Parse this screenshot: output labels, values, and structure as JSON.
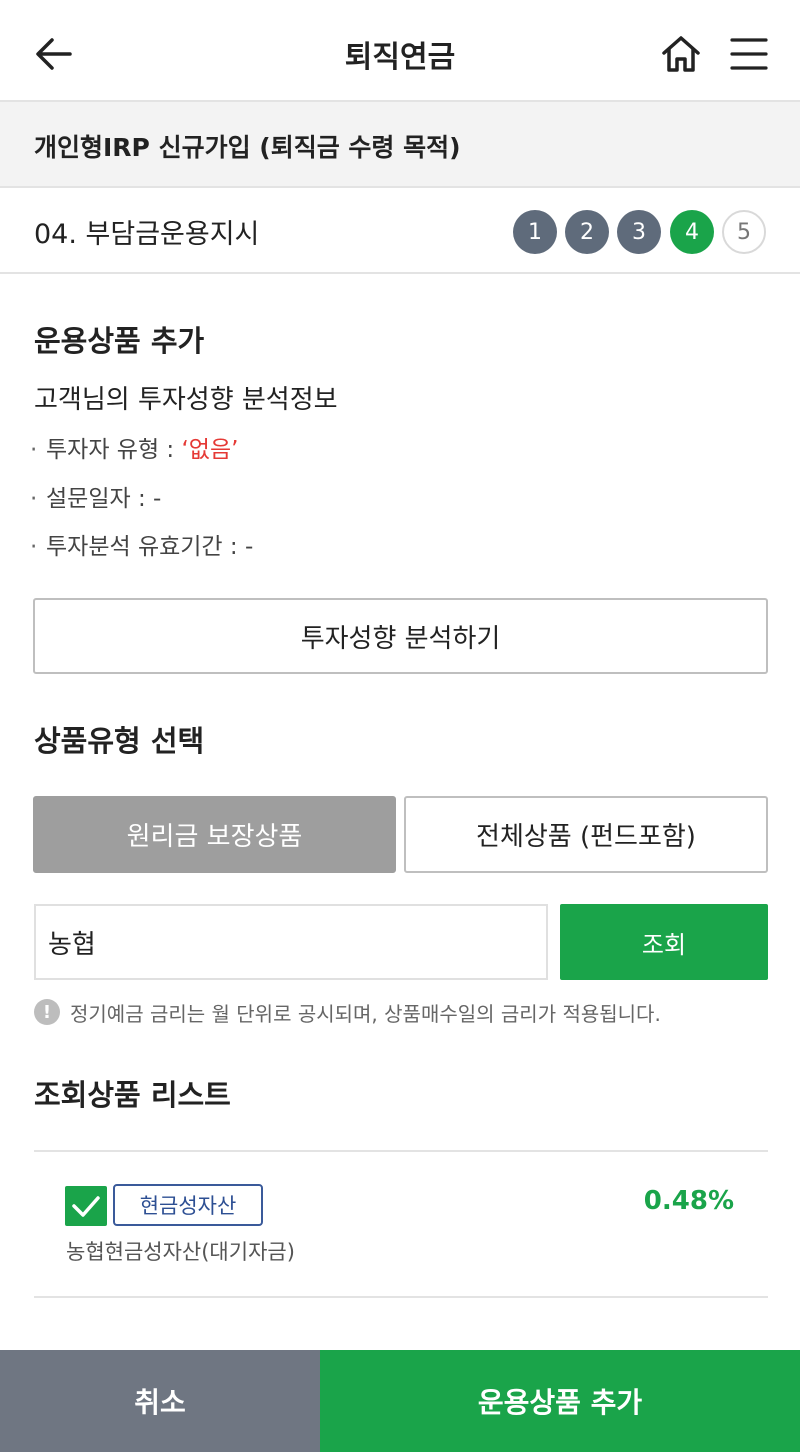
{
  "header": {
    "title": "퇴직연금",
    "back_icon": "arrow-left-icon",
    "home_icon": "home-icon",
    "menu_icon": "hamburger-menu-icon"
  },
  "subtitle": "개인형IRP 신규가입 (퇴직금 수령 목적)",
  "step": {
    "title": "04. 부담금운용지시",
    "steps": [
      "1",
      "2",
      "3",
      "4",
      "5"
    ],
    "current": 4
  },
  "product_add": {
    "title": "운용상품 추가",
    "analysis_heading": "고객님의 투자성향 분석정보",
    "investor_type_label": "투자자 유형 : ",
    "investor_type_value": "‘없음’",
    "survey_date_label": "설문일자 : -",
    "validity_label": "투자분석 유효기간 : -",
    "analyze_button": "투자성향 분석하기"
  },
  "product_type": {
    "title": "상품유형 선택",
    "option_guaranteed": "원리금 보장상품",
    "option_all": "전체상품 (펀드포함)"
  },
  "search": {
    "value": "농협",
    "button": "조회",
    "notice": "정기예금 금리는 월 단위로 공시되며, 상품매수일의 금리가 적용됩니다."
  },
  "results": {
    "title": "조회상품 리스트",
    "items": [
      {
        "tag": "현금성자산",
        "name": "농협현금성자산(대기자금)",
        "rate": "0.48%",
        "checked": true
      }
    ]
  },
  "footer": {
    "cancel": "취소",
    "add": "운용상품 추가"
  },
  "colors": {
    "accent_green": "#1aa44a",
    "step_done": "#5f6b7b",
    "cancel_gray": "#6f7682",
    "warning_red": "#e53935",
    "tag_blue": "#2d4f93"
  }
}
